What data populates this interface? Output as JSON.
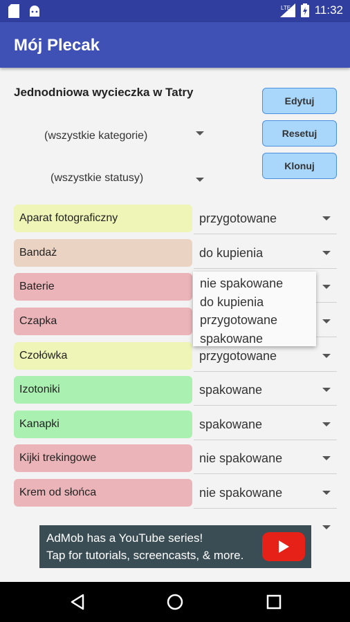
{
  "status_bar": {
    "time": "11:32"
  },
  "app": {
    "title": "Mój Plecak"
  },
  "trip": {
    "title": "Jednodniowa wycieczka w Tatry"
  },
  "filters": {
    "category": "(wszystkie kategorie)",
    "status": "(wszystkie statusy)"
  },
  "buttons": {
    "edit": "Edytuj",
    "reset": "Resetuj",
    "clone": "Klonuj"
  },
  "items": [
    {
      "name": "Aparat fotograficzny",
      "status": "przygotowane",
      "color": "#eef5b6"
    },
    {
      "name": "Bandaż",
      "status": "do kupienia",
      "color": "#ebd3c3"
    },
    {
      "name": "Baterie",
      "status": "",
      "color": "#ebb4b8"
    },
    {
      "name": "Czapka",
      "status": "",
      "color": "#ebb4b8"
    },
    {
      "name": "Czołówka",
      "status": "przygotowane",
      "color": "#eef5b6"
    },
    {
      "name": "Izotoniki",
      "status": "spakowane",
      "color": "#a9f0b1"
    },
    {
      "name": "Kanapki",
      "status": "spakowane",
      "color": "#a9f0b1"
    },
    {
      "name": "Kijki trekingowe",
      "status": "nie spakowane",
      "color": "#ebb4b8"
    },
    {
      "name": "Krem od słońca",
      "status": "nie spakowane",
      "color": "#ebb4b8"
    }
  ],
  "dropdown_options": [
    "nie spakowane",
    "do kupienia",
    "przygotowane",
    "spakowane"
  ],
  "ad": {
    "line1": "AdMob has a YouTube series!",
    "line2": "Tap for tutorials, screencasts, & more."
  }
}
